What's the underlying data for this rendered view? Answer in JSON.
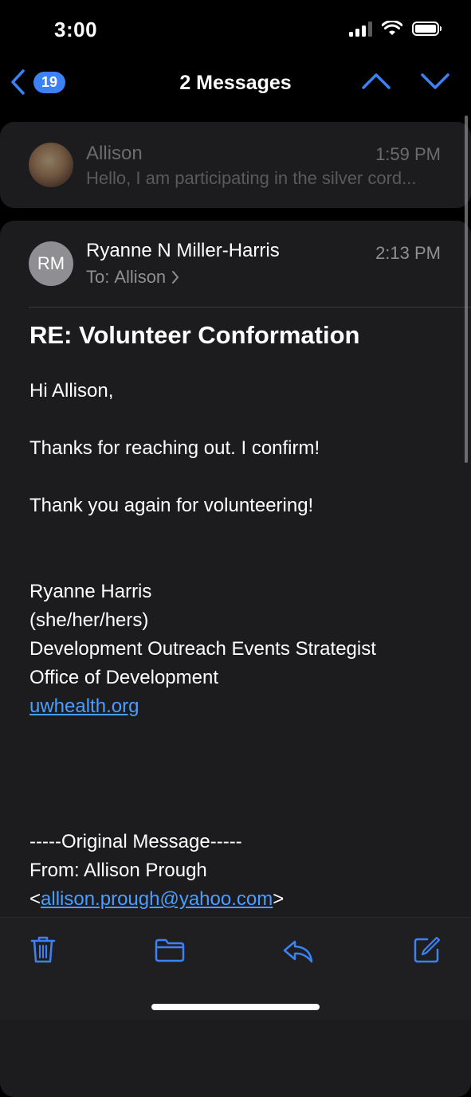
{
  "status": {
    "time": "3:00"
  },
  "nav": {
    "back_count": "19",
    "title": "2 Messages"
  },
  "collapsed_message": {
    "sender": "Allison",
    "time": "1:59 PM",
    "preview": "Hello, I am participating in the silver cord..."
  },
  "message": {
    "initials": "RM",
    "sender": "Ryanne N Miller-Harris",
    "time": "2:13 PM",
    "to_label": "To:",
    "to_name": "Allison",
    "subject": "RE: Volunteer Conformation",
    "greeting": "Hi Allison,",
    "line1": "Thanks for reaching out. I confirm!",
    "line2": "Thank you again for volunteering!",
    "sig_name": "Ryanne Harris",
    "sig_pronouns": "(she/her/hers)",
    "sig_title": "Development Outreach Events Strategist",
    "sig_office": "Office of Development",
    "sig_link": "uwhealth.org",
    "orig_header": "-----Original Message-----",
    "orig_from": "From: Allison Prough",
    "orig_email_open": "<",
    "orig_email": "allison.prough@yahoo.com",
    "orig_email_close": ">"
  },
  "colors": {
    "accent": "#3b82f6",
    "background": "#000000",
    "card": "#1c1c1e",
    "link": "#4a9eff"
  },
  "icons": [
    "chevron-left-icon",
    "chevron-up-icon",
    "chevron-down-icon",
    "trash-icon",
    "folder-icon",
    "reply-icon",
    "compose-icon",
    "wifi-icon",
    "battery-icon",
    "signal-icon"
  ]
}
